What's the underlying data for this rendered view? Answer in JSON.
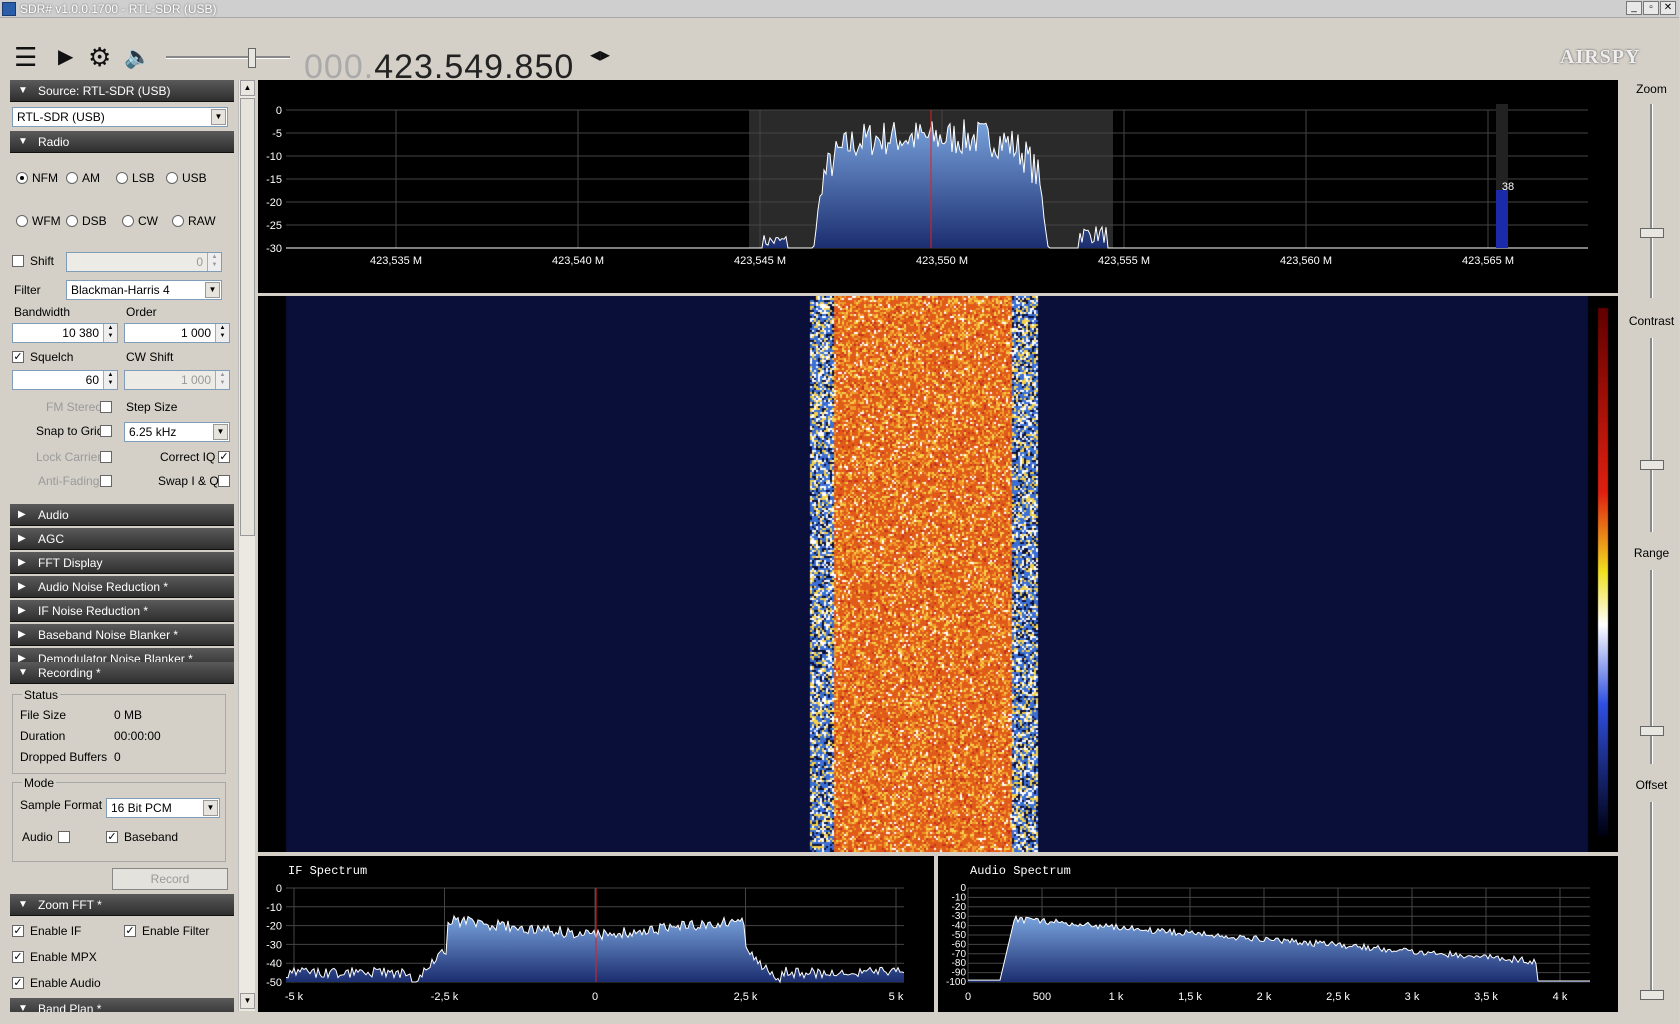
{
  "window": {
    "title": "SDR# v1.0.0.1700 - RTL-SDR (USB)"
  },
  "toolbar": {
    "frequency_dim": "000.",
    "frequency": "423.549.850",
    "brand": "AIRSPY"
  },
  "left": {
    "source_header": "Source: RTL-SDR (USB)",
    "source_value": "RTL-SDR (USB)",
    "radio_header": "Radio",
    "modes": [
      "NFM",
      "AM",
      "LSB",
      "USB",
      "WFM",
      "DSB",
      "CW",
      "RAW"
    ],
    "selected_mode": "NFM",
    "shift_label": "Shift",
    "shift_value": "0",
    "filter_label": "Filter",
    "filter_value": "Blackman-Harris 4",
    "bandwidth_label": "Bandwidth",
    "bandwidth_value": "10 380",
    "order_label": "Order",
    "order_value": "1 000",
    "squelch_label": "Squelch",
    "squelch_value": "60",
    "cw_shift_label": "CW Shift",
    "cw_shift_value": "1 000",
    "fm_stereo_label": "FM Stereo",
    "step_size_label": "Step Size",
    "snap_label": "Snap to Grid",
    "step_value": "6.25 kHz",
    "lock_carrier_label": "Lock Carrier",
    "correct_iq_label": "Correct IQ",
    "anti_fading_label": "Anti-Fading",
    "swap_iq_label": "Swap I & Q",
    "sections": [
      "Audio",
      "AGC",
      "FFT Display",
      "Audio Noise Reduction *",
      "IF Noise Reduction *",
      "Baseband Noise Blanker *",
      "Demodulator Noise Blanker *"
    ],
    "recording_header": "Recording *",
    "status_group": "Status",
    "file_size_label": "File Size",
    "file_size_value": "0 MB",
    "duration_label": "Duration",
    "duration_value": "00:00:00",
    "dropped_label": "Dropped Buffers",
    "dropped_value": "0",
    "mode_group": "Mode",
    "sample_format_label": "Sample Format",
    "sample_format_value": "16 Bit PCM",
    "audio_label": "Audio",
    "baseband_label": "Baseband",
    "record_button": "Record",
    "zoom_header": "Zoom FFT *",
    "enable_if": "Enable IF",
    "enable_filter": "Enable Filter",
    "enable_mpx": "Enable MPX",
    "enable_audio": "Enable Audio",
    "band_plan_header": "Band Plan *"
  },
  "spectrum": {
    "y_ticks": [
      "0",
      "-5",
      "-10",
      "-15",
      "-20",
      "-25",
      "-30"
    ],
    "x_ticks": [
      "423,535 M",
      "423,540 M",
      "423,545 M",
      "423,550 M",
      "423,555 M",
      "423,560 M",
      "423,565 M"
    ],
    "level_readout": "38"
  },
  "if_spectrum": {
    "title": "IF Spectrum",
    "y_ticks": [
      "0",
      "-10",
      "-20",
      "-30",
      "-40",
      "-50"
    ],
    "x_ticks": [
      "-5 k",
      "-2,5 k",
      "0",
      "2,5 k",
      "5 k"
    ]
  },
  "audio_spectrum": {
    "title": "Audio Spectrum",
    "y_ticks": [
      "0",
      "-10",
      "-20",
      "-30",
      "-40",
      "-50",
      "-60",
      "-70",
      "-80",
      "-90",
      "-100"
    ],
    "x_ticks": [
      "0",
      "500",
      "1 k",
      "1,5 k",
      "2 k",
      "2,5 k",
      "3 k",
      "3,5 k",
      "4 k"
    ]
  },
  "right": {
    "zoom_label": "Zoom",
    "contrast_label": "Contrast",
    "range_label": "Range",
    "offset_label": "Offset"
  },
  "colors": {
    "spectrum_fill": "#3f6fb5",
    "waterfall_bg": "#0a0f3a",
    "signal_hot": "#e05a1a",
    "panel_header": "#3a3a3a"
  }
}
